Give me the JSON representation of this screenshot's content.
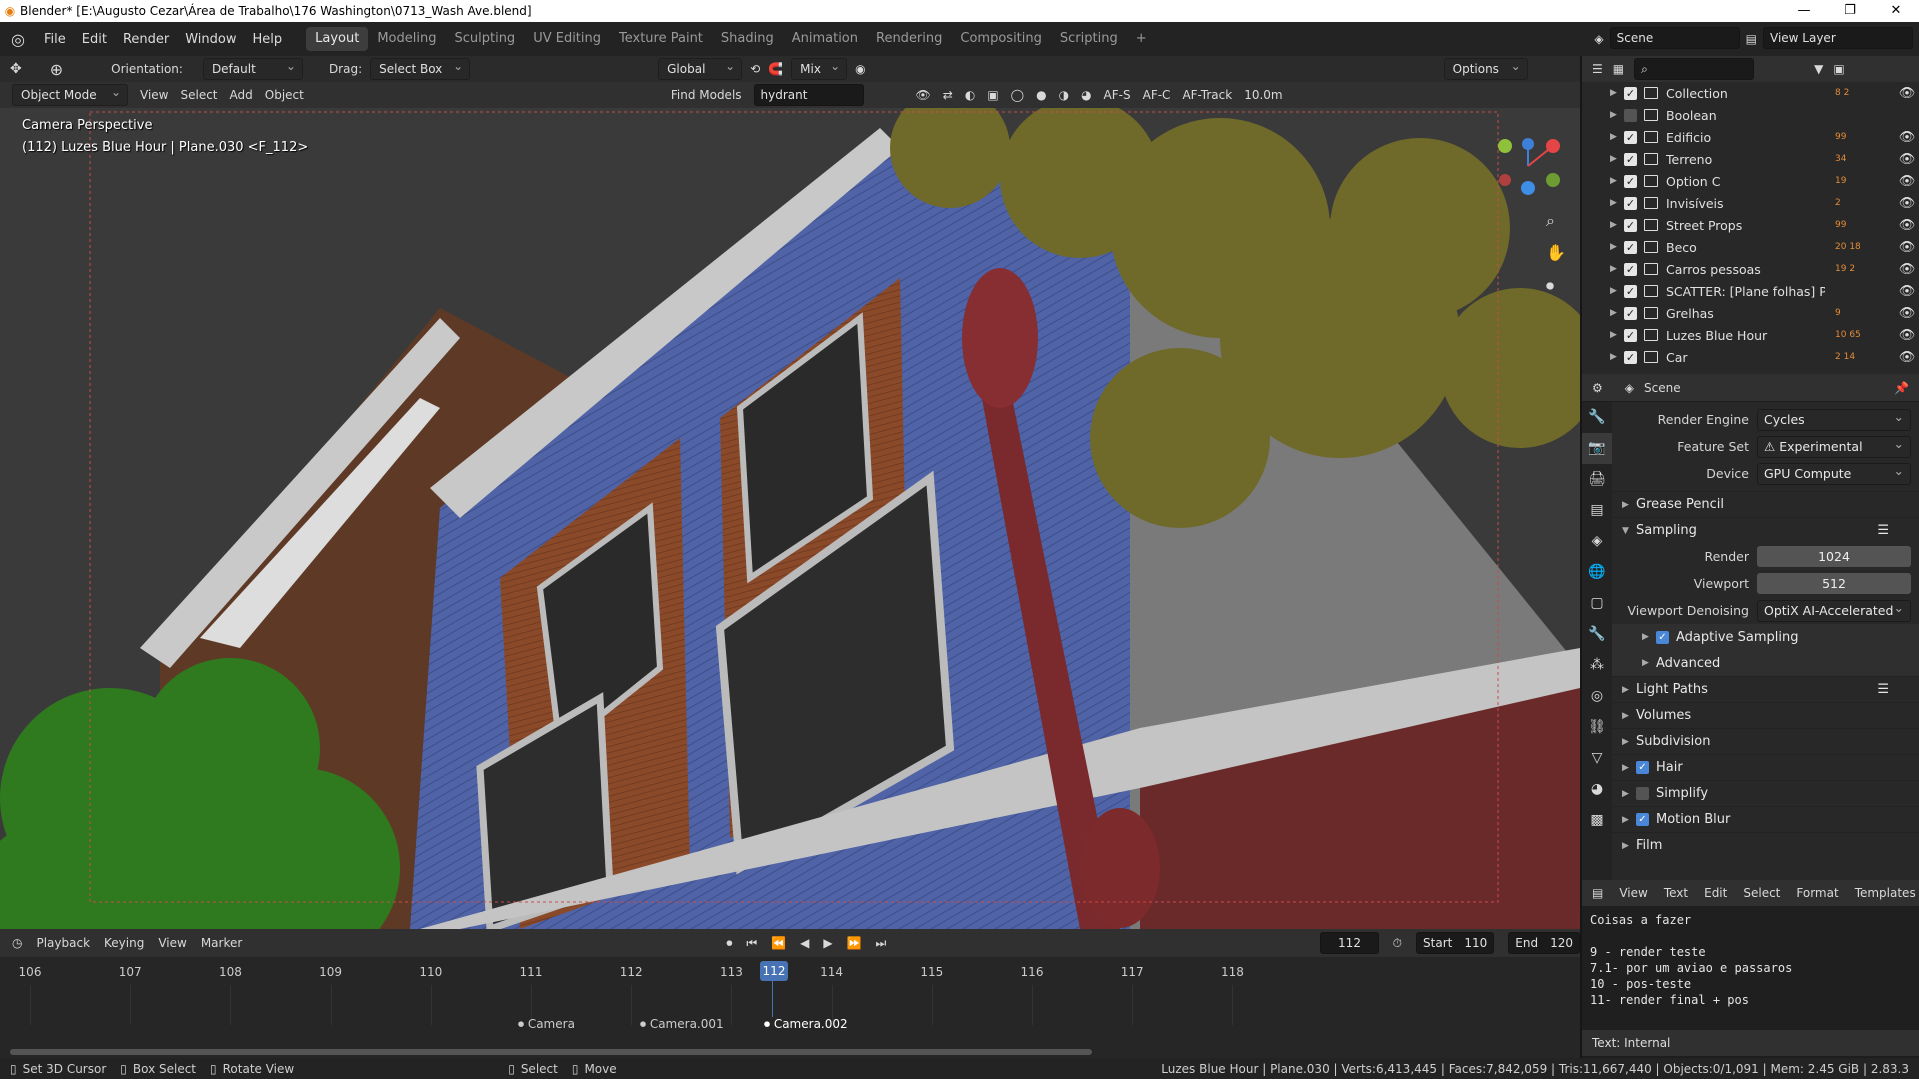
{
  "window": {
    "title": "Blender* [E:\\Augusto Cezar\\Área de Trabalho\\176 Washington\\0713_Wash Ave.blend]",
    "min": "—",
    "max": "❐",
    "close": "✕"
  },
  "menu": [
    "File",
    "Edit",
    "Render",
    "Window",
    "Help"
  ],
  "workspaces": [
    "Layout",
    "Modeling",
    "Sculpting",
    "UV Editing",
    "Texture Paint",
    "Shading",
    "Animation",
    "Rendering",
    "Compositing",
    "Scripting"
  ],
  "active_workspace": "Layout",
  "scene": {
    "label": "Scene",
    "view_layer": "View Layer"
  },
  "tool_options": {
    "orientation_label": "Orientation:",
    "orientation": "Default",
    "drag_label": "Drag:",
    "drag": "Select Box",
    "transform": "Global",
    "mix": "Mix",
    "options": "Options"
  },
  "view_header": {
    "mode": "Object Mode",
    "menus": [
      "View",
      "Select",
      "Add",
      "Object"
    ],
    "find_models": "Find Models",
    "search": "hydrant",
    "afs": "AF-S",
    "afc": "AF-C",
    "aftrack": "AF-Track",
    "distance": "10.0m"
  },
  "viewport": {
    "line1": "Camera Perspective",
    "line2": "(112) Luzes Blue Hour | Plane.030 <F_112>"
  },
  "outliner": [
    {
      "name": "Collection",
      "checked": true,
      "badges": "8 2"
    },
    {
      "name": "Boolean",
      "checked": false,
      "badges": ""
    },
    {
      "name": "Edificio",
      "checked": true,
      "badges": "99"
    },
    {
      "name": "Terreno",
      "checked": true,
      "badges": "34"
    },
    {
      "name": "Option C",
      "checked": true,
      "badges": "19"
    },
    {
      "name": "Invisíveis",
      "checked": true,
      "badges": "2"
    },
    {
      "name": "Street Props",
      "checked": true,
      "badges": "99"
    },
    {
      "name": "Beco",
      "checked": true,
      "badges": "20 18"
    },
    {
      "name": "Carros pessoas",
      "checked": true,
      "badges": "19 2"
    },
    {
      "name": "SCATTER: [Plane folhas] Particles",
      "checked": true,
      "badges": ""
    },
    {
      "name": "Grelhas",
      "checked": true,
      "badges": "9"
    },
    {
      "name": "Luzes Blue Hour",
      "checked": true,
      "badges": "10 65"
    },
    {
      "name": "Car",
      "checked": true,
      "badges": "2 14"
    }
  ],
  "props": {
    "header": "Scene",
    "render_engine_label": "Render Engine",
    "render_engine": "Cycles",
    "feature_set_label": "Feature Set",
    "feature_set": "Experimental",
    "device_label": "Device",
    "device": "GPU Compute",
    "sections": {
      "grease": "Grease Pencil",
      "sampling": "Sampling",
      "adaptive": "Adaptive Sampling",
      "advanced": "Advanced",
      "light": "Light Paths",
      "volumes": "Volumes",
      "subdivision": "Subdivision",
      "hair": "Hair",
      "simplify": "Simplify",
      "motion": "Motion Blur",
      "film": "Film"
    },
    "render_label": "Render",
    "render": "1024",
    "viewport_label": "Viewport",
    "viewport": "512",
    "denoise_label": "Viewport Denoising",
    "denoise": "OptiX AI-Accelerated"
  },
  "text_editor": {
    "menus": [
      "View",
      "Text",
      "Edit",
      "Select",
      "Format",
      "Templates"
    ],
    "lines": [
      "Coisas a fazer",
      "",
      "9 - render teste",
      "7.1- por um aviao e passaros",
      "10 - pos-teste",
      "11- render final + pos"
    ],
    "footer": "Text: Internal"
  },
  "timeline": {
    "menus": [
      "Playback",
      "Keying",
      "View",
      "Marker"
    ],
    "current": "112",
    "start_label": "Start",
    "start": "110",
    "end_label": "End",
    "end": "120",
    "ticks": [
      "106",
      "107",
      "108",
      "109",
      "110",
      "111",
      "112",
      "113",
      "114",
      "115",
      "116",
      "117",
      "118"
    ],
    "cameras": [
      "Camera",
      "Camera.001",
      "Camera.002"
    ]
  },
  "status": {
    "items": [
      "Set 3D Cursor",
      "Box Select",
      "Rotate View",
      "Select",
      "Move"
    ],
    "stats": "Luzes Blue Hour | Plane.030 | Verts:6,413,445 | Faces:7,842,059 | Tris:11,667,440 | Objects:0/1,091 | Mem: 2.45 GiB | 2.83.3"
  },
  "colors": {
    "accent": "#4b87d8",
    "current_frame": "#4772b3",
    "collection_orange": "#e38b3a"
  }
}
